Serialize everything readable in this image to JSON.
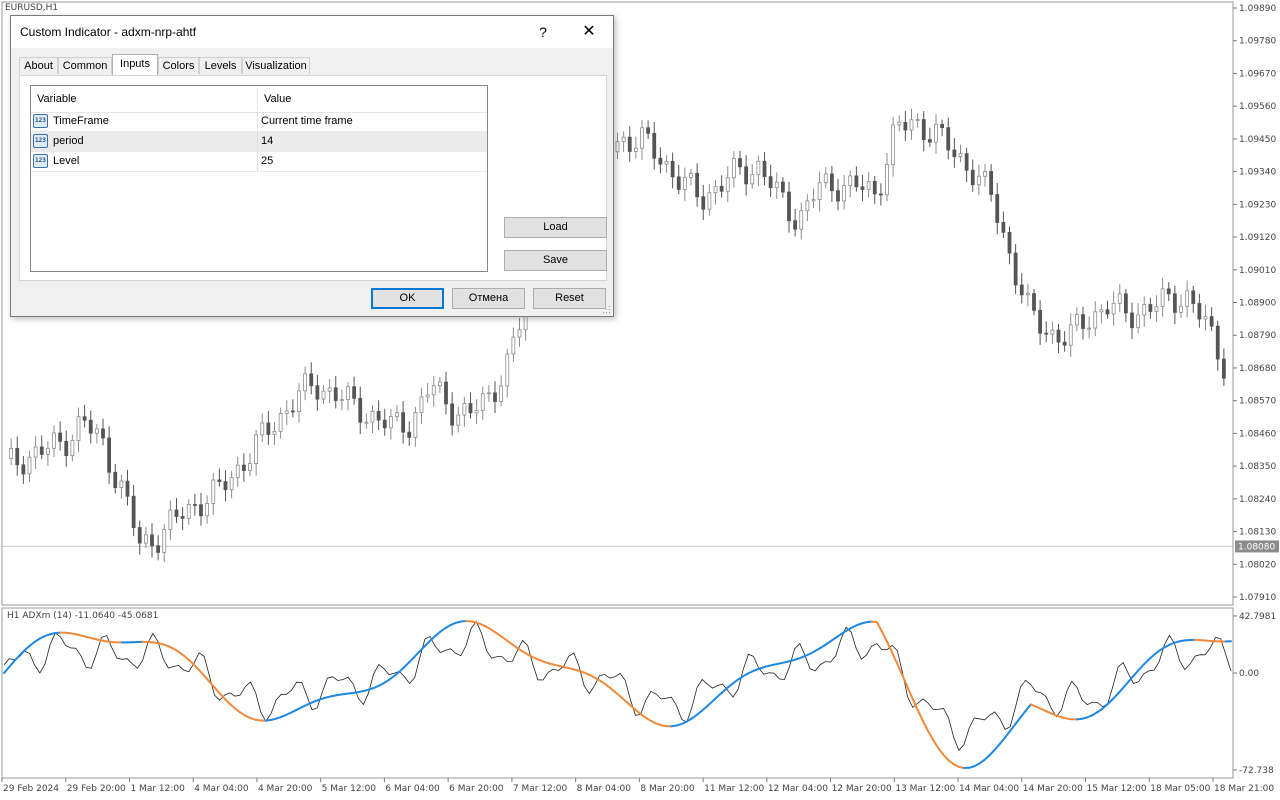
{
  "chart": {
    "symbol_label": "EURUSD,H1",
    "indicator_label": "H1 ADXm (14) -11.0640 -45.0681",
    "price_ticks": [
      "1.09890",
      "1.09780",
      "1.09670",
      "1.09560",
      "1.09450",
      "1.09340",
      "1.09230",
      "1.09120",
      "1.09010",
      "1.08900",
      "1.08790",
      "1.08680",
      "1.08570",
      "1.08460",
      "1.08350",
      "1.08240",
      "1.08130",
      "1.08020",
      "1.07910"
    ],
    "current_price": "1.08080",
    "indicator_ticks": [
      "42.7981",
      "0.00",
      "-72.738"
    ],
    "time_labels": [
      "29 Feb 2024",
      "29 Feb 20:00",
      "1 Mar 12:00",
      "4 Mar 04:00",
      "4 Mar 20:00",
      "5 Mar 12:00",
      "6 Mar 04:00",
      "6 Mar 20:00",
      "7 Mar 12:00",
      "8 Mar 04:00",
      "8 Mar 20:00",
      "11 Mar 12:00",
      "12 Mar 04:00",
      "12 Mar 20:00",
      "13 Mar 12:00",
      "14 Mar 04:00",
      "14 Mar 20:00",
      "15 Mar 12:00",
      "18 Mar 05:00",
      "18 Mar 21:00"
    ],
    "colors": {
      "candle": "#8c8c8c",
      "candle_dark": "#555555",
      "adx_up": "#1e88e5",
      "adx_down": "#f08a3c",
      "di_line": "#222222",
      "price_tag_bg": "#8c8c8c"
    }
  },
  "chart_data": {
    "type": "line",
    "series": [
      {
        "name": "EURUSD,H1",
        "values": [
          1.0835,
          1.0838,
          1.084,
          1.0843,
          1.085,
          1.0843,
          1.0828,
          1.0808,
          1.0812,
          1.0818,
          1.0823,
          1.0826,
          1.0834,
          1.0842,
          1.085,
          1.0858,
          1.0862,
          1.086,
          1.0855,
          1.0852,
          1.0848,
          1.085,
          1.0862,
          1.0855,
          1.0852,
          1.0858,
          1.087,
          1.089,
          1.095,
          1.096,
          1.094,
          1.0942,
          1.0945,
          1.0944,
          1.0938,
          1.093,
          1.0925,
          1.093,
          1.0934,
          1.0936,
          1.0925,
          1.0918,
          1.0928,
          1.093,
          1.0929,
          1.0926,
          1.0948,
          1.095,
          1.0948,
          1.094,
          1.0935,
          1.0925,
          1.0905,
          1.0885,
          1.088,
          1.0878,
          1.0885,
          1.0889,
          1.0886,
          1.0888,
          1.089,
          1.0893,
          1.0883,
          1.087
        ]
      }
    ],
    "ylim": [
      1.0791,
      1.0989
    ]
  },
  "dialog": {
    "title": "Custom Indicator - adxm-nrp-ahtf",
    "help_label": "?",
    "close_label": "✕",
    "tabs": [
      {
        "label": "About"
      },
      {
        "label": "Common"
      },
      {
        "label": "Inputs"
      },
      {
        "label": "Colors"
      },
      {
        "label": "Levels"
      },
      {
        "label": "Visualization"
      }
    ],
    "active_tab": "Inputs",
    "grid": {
      "headers": {
        "variable": "Variable",
        "value": "Value"
      },
      "icon_text": "123",
      "rows": [
        {
          "variable": "TimeFrame",
          "value": "Current time frame"
        },
        {
          "variable": "period",
          "value": "14"
        },
        {
          "variable": "Level",
          "value": "25"
        }
      ]
    },
    "load_label": "Load",
    "save_label": "Save",
    "ok_label": "OK",
    "cancel_label": "Отмена",
    "reset_label": "Reset"
  }
}
